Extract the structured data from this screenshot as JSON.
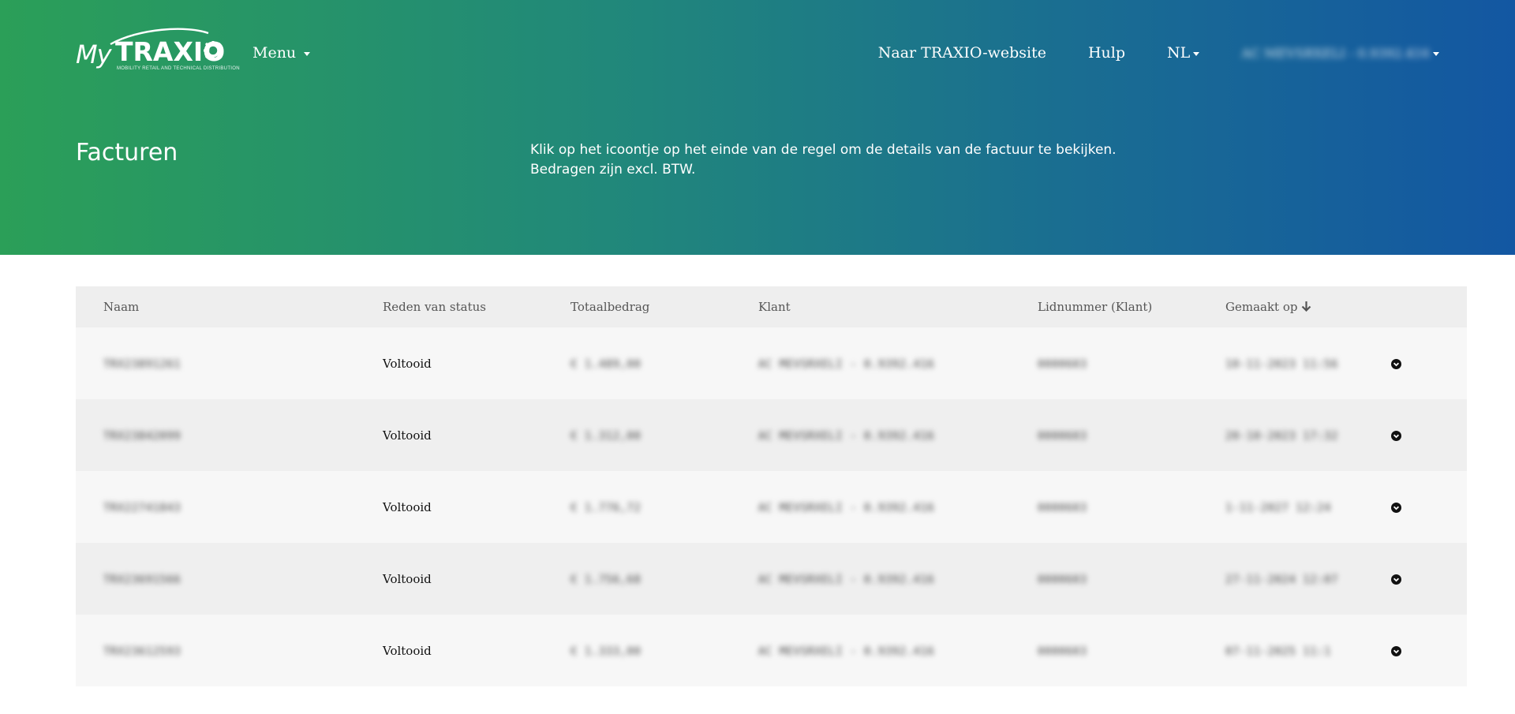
{
  "brand": {
    "logo_prefix": "My",
    "logo_word": "TRAXIO",
    "logo_tagline": "MOBILITY RETAIL AND TECHNICAL DISTRIBUTION"
  },
  "nav": {
    "menu_label": "Menu",
    "website_link": "Naar TRAXIO-website",
    "help_link": "Hulp",
    "language": "NL",
    "account_label": "AC MEVSRXELI - 0.9392.416"
  },
  "page": {
    "title": "Facturen",
    "intro_line1": "Klik op het icoontje op het einde van de regel om de details van de factuur te bekijken.",
    "intro_line2": "Bedragen zijn excl. BTW."
  },
  "table": {
    "headers": [
      "Naam",
      "Reden van status",
      "Totaalbedrag",
      "Klant",
      "Lidnummer (Klant)",
      "Gemaakt op"
    ],
    "sort_column": "Gemaakt op",
    "sort_direction": "descending",
    "rows": [
      {
        "naam": "TRX23891261",
        "status": "Voltooid",
        "totaal": "€ 1.489,00",
        "klant": "AC MEVSRXELI - 0.9392.416",
        "lidnummer": "0000603",
        "datum": "10-11-2023 11:56"
      },
      {
        "naam": "TRX23842099",
        "status": "Voltooid",
        "totaal": "€ 1.312,00",
        "klant": "AC MEVSRXELI - 0.9392.416",
        "lidnummer": "0000603",
        "datum": "20-10-2023 17:32"
      },
      {
        "naam": "TRX22741843",
        "status": "Voltooid",
        "totaal": "€ 1.776,72",
        "klant": "AC MEVSRXELI - 0.9392.416",
        "lidnummer": "0000603",
        "datum": "1-11-2027 12:24"
      },
      {
        "naam": "TRX23691566",
        "status": "Voltooid",
        "totaal": "€ 1.756,68",
        "klant": "AC MEVSRXELI - 0.9392.416",
        "lidnummer": "0000603",
        "datum": "27-11-2024 12:07"
      },
      {
        "naam": "TRX23612593",
        "status": "Voltooid",
        "totaal": "€ 1.333,00",
        "klant": "AC MEVSRXELI - 0.9392.416",
        "lidnummer": "0000603",
        "datum": "07-11-2025 11:1"
      }
    ]
  },
  "icons": {
    "sort": "arrow-down-icon",
    "row_action": "chevron-circle-down-icon",
    "dropdown": "caret-down-icon"
  },
  "colors": {
    "hero_gradient_start": "#2b9f58",
    "hero_gradient_end": "#1357a2",
    "header_row": "#eeeeee",
    "row_odd": "#f7f7f7",
    "row_even": "#efefef"
  }
}
